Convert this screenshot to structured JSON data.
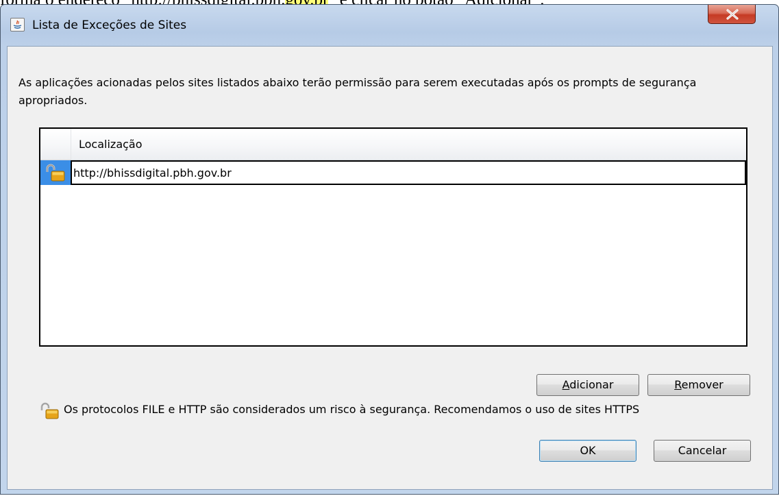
{
  "document": {
    "text_before": "forma o endereço \"http://bhissdigital.pbh.",
    "text_highlight": "gov.br",
    "text_after": "\" e clicar no botão \"Adicionar\"."
  },
  "window": {
    "title": "Lista de Exceções de Sites",
    "description": "As aplicações acionadas pelos sites listados abaixo terão permissão para serem executadas após os prompts de segurança apropriados."
  },
  "table": {
    "column_header": "Localização",
    "rows": [
      {
        "icon": "unlocked-padlock-icon",
        "value": "http://bhissdigital.pbh.gov.br"
      }
    ]
  },
  "buttons": {
    "add": {
      "label": "Adicionar",
      "mnemonic": "A"
    },
    "remove": {
      "label": "Remover",
      "mnemonic": "R"
    },
    "ok": "OK",
    "cancel": "Cancelar"
  },
  "warning": {
    "icon": "unlocked-padlock-icon",
    "text": "Os protocolos FILE e HTTP são considerados um risco à segurança. Recomendamos o uso de sites HTTPS"
  },
  "colors": {
    "selected_row": "#3b8ee6",
    "close_button": "#c53a24",
    "dialog_background": "#f0f0f0"
  }
}
